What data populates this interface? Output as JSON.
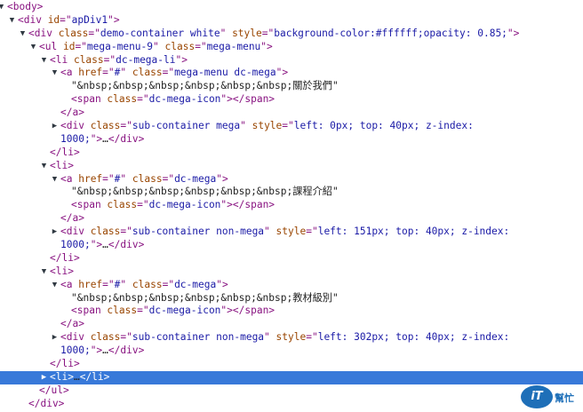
{
  "lines": [
    {
      "indent": 0,
      "arrow": "down",
      "parts": [
        [
          "tag",
          "<body>"
        ]
      ]
    },
    {
      "indent": 1,
      "arrow": "down",
      "parts": [
        [
          "tag",
          "<div "
        ],
        [
          "attr",
          "id"
        ],
        [
          "tag",
          "=\""
        ],
        [
          "val",
          "apDiv1"
        ],
        [
          "tag",
          "\">"
        ]
      ]
    },
    {
      "indent": 2,
      "arrow": "down",
      "parts": [
        [
          "tag",
          "<div "
        ],
        [
          "attr",
          "class"
        ],
        [
          "tag",
          "=\""
        ],
        [
          "val",
          "demo-container white"
        ],
        [
          "tag",
          "\" "
        ],
        [
          "attr",
          "style"
        ],
        [
          "tag",
          "=\""
        ],
        [
          "val",
          "background-color:#ffffff;opacity: 0.85;"
        ],
        [
          "tag",
          "\">"
        ]
      ]
    },
    {
      "indent": 3,
      "arrow": "down",
      "parts": [
        [
          "tag",
          "<ul "
        ],
        [
          "attr",
          "id"
        ],
        [
          "tag",
          "=\""
        ],
        [
          "val",
          "mega-menu-9"
        ],
        [
          "tag",
          "\" "
        ],
        [
          "attr",
          "class"
        ],
        [
          "tag",
          "=\""
        ],
        [
          "val",
          "mega-menu"
        ],
        [
          "tag",
          "\">"
        ]
      ]
    },
    {
      "indent": 4,
      "arrow": "down",
      "parts": [
        [
          "tag",
          "<li "
        ],
        [
          "attr",
          "class"
        ],
        [
          "tag",
          "=\""
        ],
        [
          "val",
          "dc-mega-li"
        ],
        [
          "tag",
          "\">"
        ]
      ]
    },
    {
      "indent": 5,
      "arrow": "down",
      "parts": [
        [
          "tag",
          "<a "
        ],
        [
          "attr",
          "href"
        ],
        [
          "tag",
          "=\""
        ],
        [
          "val",
          "#"
        ],
        [
          "tag",
          "\" "
        ],
        [
          "attr",
          "class"
        ],
        [
          "tag",
          "=\""
        ],
        [
          "val",
          "mega-menu dc-mega"
        ],
        [
          "tag",
          "\">"
        ]
      ]
    },
    {
      "indent": 6,
      "arrow": "",
      "parts": [
        [
          "txt",
          "\"&nbsp;&nbsp;&nbsp;&nbsp;&nbsp;&nbsp;關於我們\""
        ]
      ]
    },
    {
      "indent": 6,
      "arrow": "",
      "parts": [
        [
          "tag",
          "<span "
        ],
        [
          "attr",
          "class"
        ],
        [
          "tag",
          "=\""
        ],
        [
          "val",
          "dc-mega-icon"
        ],
        [
          "tag",
          "\"></span>"
        ]
      ]
    },
    {
      "indent": 5,
      "arrow": "",
      "parts": [
        [
          "tag",
          "</a>"
        ]
      ]
    },
    {
      "indent": 5,
      "arrow": "right",
      "parts": [
        [
          "tag",
          "<div "
        ],
        [
          "attr",
          "class"
        ],
        [
          "tag",
          "=\""
        ],
        [
          "val",
          "sub-container mega"
        ],
        [
          "tag",
          "\" "
        ],
        [
          "attr",
          "style"
        ],
        [
          "tag",
          "=\""
        ],
        [
          "val",
          "left: 0px; top: 40px; z-index:"
        ]
      ]
    },
    {
      "indent": 5,
      "arrow": "",
      "wrap": true,
      "parts": [
        [
          "val",
          "1000;"
        ],
        [
          "tag",
          "\">"
        ],
        [
          "txt",
          "…"
        ],
        [
          "tag",
          "</div>"
        ]
      ]
    },
    {
      "indent": 4,
      "arrow": "",
      "parts": [
        [
          "tag",
          "</li>"
        ]
      ]
    },
    {
      "indent": 4,
      "arrow": "down",
      "parts": [
        [
          "tag",
          "<li>"
        ]
      ]
    },
    {
      "indent": 5,
      "arrow": "down",
      "parts": [
        [
          "tag",
          "<a "
        ],
        [
          "attr",
          "href"
        ],
        [
          "tag",
          "=\""
        ],
        [
          "val",
          "#"
        ],
        [
          "tag",
          "\" "
        ],
        [
          "attr",
          "class"
        ],
        [
          "tag",
          "=\""
        ],
        [
          "val",
          "dc-mega"
        ],
        [
          "tag",
          "\">"
        ]
      ]
    },
    {
      "indent": 6,
      "arrow": "",
      "parts": [
        [
          "txt",
          "\"&nbsp;&nbsp;&nbsp;&nbsp;&nbsp;&nbsp;課程介紹\""
        ]
      ]
    },
    {
      "indent": 6,
      "arrow": "",
      "parts": [
        [
          "tag",
          "<span "
        ],
        [
          "attr",
          "class"
        ],
        [
          "tag",
          "=\""
        ],
        [
          "val",
          "dc-mega-icon"
        ],
        [
          "tag",
          "\"></span>"
        ]
      ]
    },
    {
      "indent": 5,
      "arrow": "",
      "parts": [
        [
          "tag",
          "</a>"
        ]
      ]
    },
    {
      "indent": 5,
      "arrow": "right",
      "parts": [
        [
          "tag",
          "<div "
        ],
        [
          "attr",
          "class"
        ],
        [
          "tag",
          "=\""
        ],
        [
          "val",
          "sub-container non-mega"
        ],
        [
          "tag",
          "\" "
        ],
        [
          "attr",
          "style"
        ],
        [
          "tag",
          "=\""
        ],
        [
          "val",
          "left: 151px; top: 40px; z-index:"
        ]
      ]
    },
    {
      "indent": 5,
      "arrow": "",
      "wrap": true,
      "parts": [
        [
          "val",
          "1000;"
        ],
        [
          "tag",
          "\">"
        ],
        [
          "txt",
          "…"
        ],
        [
          "tag",
          "</div>"
        ]
      ]
    },
    {
      "indent": 4,
      "arrow": "",
      "parts": [
        [
          "tag",
          "</li>"
        ]
      ]
    },
    {
      "indent": 4,
      "arrow": "down",
      "parts": [
        [
          "tag",
          "<li>"
        ]
      ]
    },
    {
      "indent": 5,
      "arrow": "down",
      "parts": [
        [
          "tag",
          "<a "
        ],
        [
          "attr",
          "href"
        ],
        [
          "tag",
          "=\""
        ],
        [
          "val",
          "#"
        ],
        [
          "tag",
          "\" "
        ],
        [
          "attr",
          "class"
        ],
        [
          "tag",
          "=\""
        ],
        [
          "val",
          "dc-mega"
        ],
        [
          "tag",
          "\">"
        ]
      ]
    },
    {
      "indent": 6,
      "arrow": "",
      "parts": [
        [
          "txt",
          "\"&nbsp;&nbsp;&nbsp;&nbsp;&nbsp;&nbsp;教材級別\""
        ]
      ]
    },
    {
      "indent": 6,
      "arrow": "",
      "parts": [
        [
          "tag",
          "<span "
        ],
        [
          "attr",
          "class"
        ],
        [
          "tag",
          "=\""
        ],
        [
          "val",
          "dc-mega-icon"
        ],
        [
          "tag",
          "\"></span>"
        ]
      ]
    },
    {
      "indent": 5,
      "arrow": "",
      "parts": [
        [
          "tag",
          "</a>"
        ]
      ]
    },
    {
      "indent": 5,
      "arrow": "right",
      "parts": [
        [
          "tag",
          "<div "
        ],
        [
          "attr",
          "class"
        ],
        [
          "tag",
          "=\""
        ],
        [
          "val",
          "sub-container non-mega"
        ],
        [
          "tag",
          "\" "
        ],
        [
          "attr",
          "style"
        ],
        [
          "tag",
          "=\""
        ],
        [
          "val",
          "left: 302px; top: 40px; z-index:"
        ]
      ]
    },
    {
      "indent": 5,
      "arrow": "",
      "wrap": true,
      "parts": [
        [
          "val",
          "1000;"
        ],
        [
          "tag",
          "\">"
        ],
        [
          "txt",
          "…"
        ],
        [
          "tag",
          "</div>"
        ]
      ]
    },
    {
      "indent": 4,
      "arrow": "",
      "parts": [
        [
          "tag",
          "</li>"
        ]
      ]
    },
    {
      "indent": 4,
      "arrow": "right",
      "selected": true,
      "parts": [
        [
          "tag",
          "<li>"
        ],
        [
          "txt",
          "…"
        ],
        [
          "tag",
          "</li>"
        ]
      ]
    },
    {
      "indent": 3,
      "arrow": "",
      "parts": [
        [
          "tag",
          "</ul>"
        ]
      ]
    },
    {
      "indent": 2,
      "arrow": "",
      "parts": [
        [
          "tag",
          "</div>"
        ]
      ]
    }
  ],
  "watermark": {
    "mark": "iT",
    "label": "幫忙"
  }
}
